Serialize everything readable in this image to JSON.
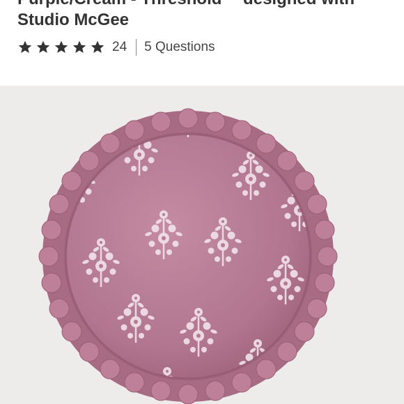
{
  "product": {
    "title_line1": "Purple/Cream - Threshold™ designed with",
    "title_line2": "Studio McGee"
  },
  "rating": {
    "stars": 5,
    "max_stars": 5,
    "count": "24",
    "questions": "5 Questions"
  },
  "icons": {
    "star": "star-icon"
  },
  "colors": {
    "star": "#333333",
    "text": "#333333",
    "image_background": "#eeecea",
    "pillow": "#b87a93",
    "pattern": "#f1e3ea"
  }
}
